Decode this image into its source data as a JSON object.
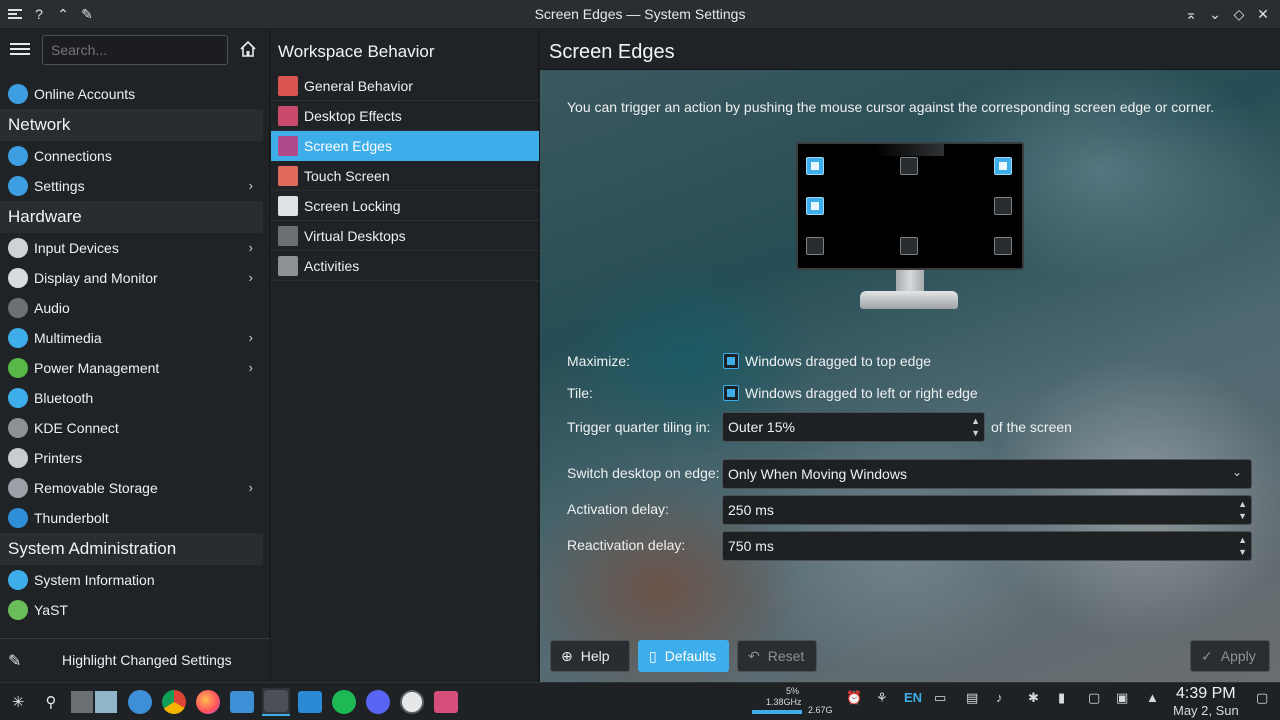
{
  "window": {
    "title": "Screen Edges — System Settings"
  },
  "sidebar": {
    "search_placeholder": "Search...",
    "items": [
      {
        "type": "item",
        "label": "Online Accounts",
        "icon": "globe-icon",
        "color": "#3c9de0",
        "chevron": false
      },
      {
        "type": "category",
        "label": "Network"
      },
      {
        "type": "item",
        "label": "Connections",
        "icon": "globe-icon",
        "color": "#3c9de0",
        "chevron": false
      },
      {
        "type": "item",
        "label": "Settings",
        "icon": "globe-icon",
        "color": "#3c9de0",
        "chevron": true
      },
      {
        "type": "category",
        "label": "Hardware"
      },
      {
        "type": "item",
        "label": "Input Devices",
        "icon": "keyboard-icon",
        "color": "#cfd3d6",
        "chevron": true
      },
      {
        "type": "item",
        "label": "Display and Monitor",
        "icon": "monitor-icon",
        "color": "#d9dcdf",
        "chevron": true
      },
      {
        "type": "item",
        "label": "Audio",
        "icon": "speaker-icon",
        "color": "#6b7075",
        "chevron": false
      },
      {
        "type": "item",
        "label": "Multimedia",
        "icon": "multimedia-icon",
        "color": "#3daee9",
        "chevron": true
      },
      {
        "type": "item",
        "label": "Power Management",
        "icon": "power-icon",
        "color": "#57b846",
        "chevron": true
      },
      {
        "type": "item",
        "label": "Bluetooth",
        "icon": "bluetooth-icon",
        "color": "#3daee9",
        "chevron": false
      },
      {
        "type": "item",
        "label": "KDE Connect",
        "icon": "phone-icon",
        "color": "#8c9196",
        "chevron": false
      },
      {
        "type": "item",
        "label": "Printers",
        "icon": "printer-icon",
        "color": "#c9ccd0",
        "chevron": false
      },
      {
        "type": "item",
        "label": "Removable Storage",
        "icon": "usb-drive-icon",
        "color": "#9aa0a6",
        "chevron": true
      },
      {
        "type": "item",
        "label": "Thunderbolt",
        "icon": "thunderbolt-icon",
        "color": "#2f8ed8",
        "chevron": false
      },
      {
        "type": "category",
        "label": "System Administration"
      },
      {
        "type": "item",
        "label": "System Information",
        "icon": "info-icon",
        "color": "#3daee9",
        "chevron": false
      },
      {
        "type": "item",
        "label": "YaST",
        "icon": "yast-icon",
        "color": "#6abe5a",
        "chevron": false
      }
    ],
    "footer_label": "Highlight Changed Settings"
  },
  "subpanel": {
    "title": "Workspace Behavior",
    "items": [
      {
        "label": "General Behavior",
        "icon": "general-behavior-icon",
        "color": "#d9534f",
        "active": false
      },
      {
        "label": "Desktop Effects",
        "icon": "desktop-effects-icon",
        "color": "#c94a6a",
        "active": false
      },
      {
        "label": "Screen Edges",
        "icon": "screen-edges-icon",
        "color": "#b04a8a",
        "active": true
      },
      {
        "label": "Touch Screen",
        "icon": "touch-screen-icon",
        "color": "#e06a5a",
        "active": false
      },
      {
        "label": "Screen Locking",
        "icon": "screen-lock-icon",
        "color": "#dfe2e4",
        "active": false
      },
      {
        "label": "Virtual Desktops",
        "icon": "virtual-desktops-icon",
        "color": "#6b7075",
        "active": false
      },
      {
        "label": "Activities",
        "icon": "activities-icon",
        "color": "#8c9196",
        "active": false
      }
    ]
  },
  "main": {
    "title": "Screen Edges",
    "description": "You can trigger an action by pushing the mouse cursor against the corresponding screen edge or corner.",
    "edges": {
      "top_left": true,
      "top": false,
      "top_right": true,
      "left": true,
      "right": false,
      "bottom_left": false,
      "bottom": false,
      "bottom_right": false
    },
    "maximize_label": "Maximize:",
    "maximize_text": "Windows dragged to top edge",
    "tile_label": "Tile:",
    "tile_text": "Windows dragged to left or right edge",
    "quarter_label": "Trigger quarter tiling in:",
    "quarter_value": "Outer 15%",
    "quarter_suffix": "of the screen",
    "switch_label": "Switch desktop on edge:",
    "switch_value": "Only When Moving Windows",
    "activation_label": "Activation delay:",
    "activation_value": "250 ms",
    "reactivation_label": "Reactivation delay:",
    "reactivation_value": "750 ms",
    "buttons": {
      "help": "Help",
      "defaults": "Defaults",
      "reset": "Reset",
      "apply": "Apply"
    }
  },
  "taskbar": {
    "cpu_percent": "5%",
    "cpu_freq": "1.38GHz",
    "mem": "2.67G",
    "keyboard_layout": "EN",
    "time": "4:39 PM",
    "date": "May 2, Sun"
  },
  "colors": {
    "accent": "#3daee9",
    "panel": "#202326",
    "window": "#1b1e20"
  }
}
